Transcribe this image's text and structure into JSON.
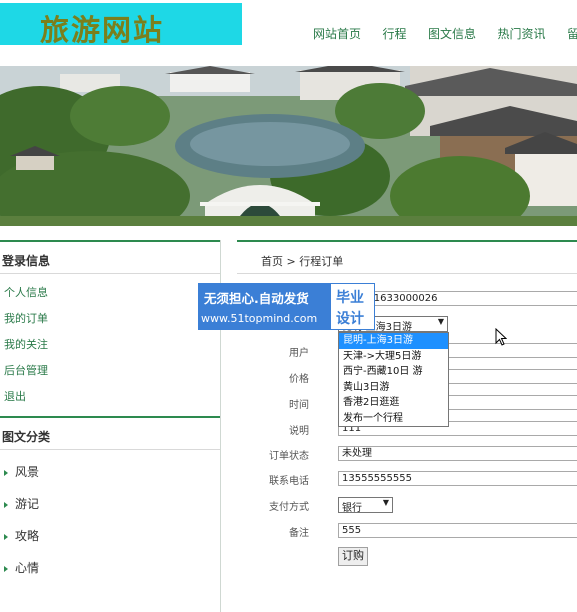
{
  "site": {
    "logo": "旅游网站"
  },
  "nav": [
    "网站首页",
    "行程",
    "图文信息",
    "热门资讯",
    "留言"
  ],
  "sidebar": {
    "login_title": "登录信息",
    "login_links": [
      "个人信息",
      "我的订单",
      "我的关注",
      "后台管理",
      "退出"
    ],
    "category_title": "图文分类",
    "categories": [
      "风景",
      "游记",
      "攻略",
      "心情"
    ]
  },
  "main": {
    "breadcrumb": "首页 > 行程订单",
    "order_no": "904101633000026",
    "trip_value": "昆明-上海3日游",
    "trip_options": [
      "昆明-上海3日游",
      "天津->大理5日游",
      "西宁-西藏10日 游",
      "黄山3日游",
      "香港2日逛逛",
      "发布一个行程"
    ],
    "labels": {
      "user": "用户",
      "price": "价格",
      "time": "时间",
      "desc": "说明",
      "status": "订单状态",
      "phone": "联系电话",
      "pay": "支付方式",
      "note": "备注"
    },
    "desc_value": "111",
    "status_value": "未处理",
    "phone_value": "13555555555",
    "pay_value": "银行",
    "note_value": "555",
    "submit": "订购"
  },
  "watermark": {
    "line1": "无须担心.自动发货",
    "line2": "www.51topmind.com",
    "r1": "毕业",
    "r2": "设计"
  },
  "colors": {
    "logo_bg": "#1ed8e6",
    "accent_green": "#2d8a4f",
    "link_green": "#2a7a49",
    "highlight": "#1e90ff",
    "watermark_blue": "#3b7fd6"
  }
}
